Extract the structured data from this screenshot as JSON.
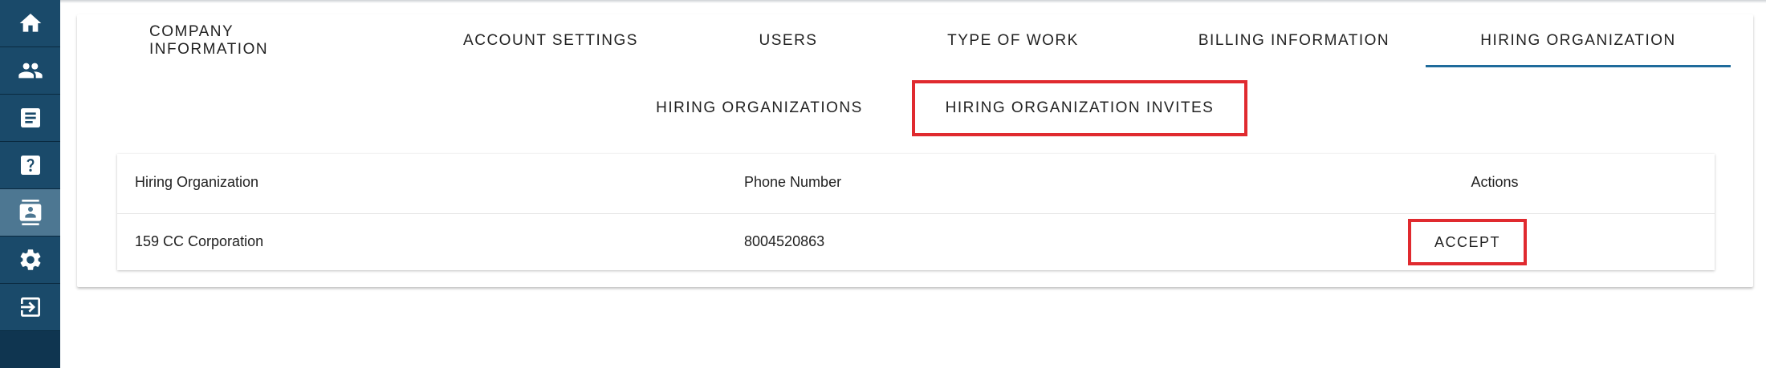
{
  "sidebar": {
    "items": [
      {
        "icon": "home-icon"
      },
      {
        "icon": "people-icon"
      },
      {
        "icon": "document-icon"
      },
      {
        "icon": "help-icon"
      },
      {
        "icon": "contact-card-icon",
        "active": true
      },
      {
        "icon": "gear-icon"
      },
      {
        "icon": "logout-icon"
      }
    ]
  },
  "tabs": [
    {
      "label": "COMPANY INFORMATION"
    },
    {
      "label": "ACCOUNT SETTINGS"
    },
    {
      "label": "USERS"
    },
    {
      "label": "TYPE OF WORK"
    },
    {
      "label": "BILLING INFORMATION"
    },
    {
      "label": "HIRING ORGANIZATION",
      "active": true
    }
  ],
  "subtabs": [
    {
      "label": "HIRING ORGANIZATIONS"
    },
    {
      "label": "HIRING ORGANIZATION INVITES",
      "highlighted": true
    }
  ],
  "table": {
    "headers": [
      "Hiring Organization",
      "Phone Number",
      "Actions"
    ],
    "rows": [
      {
        "organization": "159 CC Corporation",
        "phone": "8004520863",
        "action_label": "ACCEPT"
      }
    ]
  },
  "colors": {
    "sidebar_bg": "#0f3550",
    "sidebar_active": "#4d7792",
    "tab_indicator": "#1f6b9b",
    "highlight_red": "#e02a2f"
  }
}
